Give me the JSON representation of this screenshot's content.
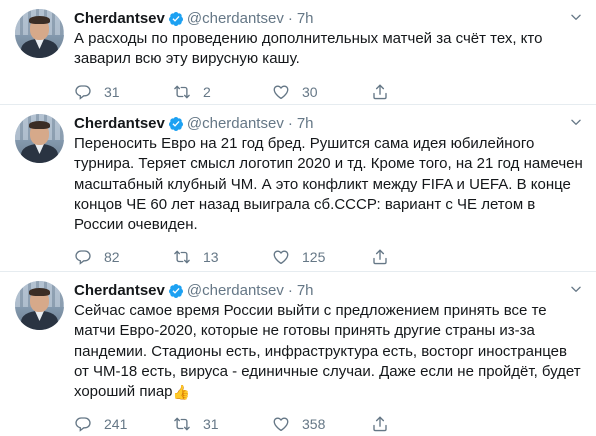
{
  "tweets": [
    {
      "name": "Cherdantsev",
      "handle": "@cherdantsev",
      "separator": "·",
      "time": "7h",
      "text": "А расходы по проведению дополнительных матчей за счёт тех, кто заварил всю эту вирусную кашу.",
      "replies": "31",
      "retweets": "2",
      "likes": "30"
    },
    {
      "name": "Cherdantsev",
      "handle": "@cherdantsev",
      "separator": "·",
      "time": "7h",
      "text": "Переносить Евро на 21 год бред. Рушится сама идея юбилейного турнира. Теряет смысл логотип 2020 и тд. Кроме того, на 21 год намечен масштабный клубный ЧМ. А это конфликт между FIFA и UEFA. В конце концов ЧЕ 60 лет назад выиграла сб.СССР: вариант с ЧЕ летом в России очевиден.",
      "replies": "82",
      "retweets": "13",
      "likes": "125"
    },
    {
      "name": "Cherdantsev",
      "handle": "@cherdantsev",
      "separator": "·",
      "time": "7h",
      "text": "Сейчас самое время России выйти с предложением принять все те матчи Евро-2020, которые не готовы принять другие страны из-за пандемии. Стадионы есть, инфраструктура есть, восторг иностранцев от ЧМ-18 есть, вируса - единичные случаи. Даже если не пройдёт, будет хороший пиар",
      "emoji": "👍",
      "replies": "241",
      "retweets": "31",
      "likes": "358"
    }
  ],
  "icons": {
    "verified": "verified-badge-icon",
    "reply": "reply-icon",
    "retweet": "retweet-icon",
    "like": "heart-icon",
    "share": "share-icon",
    "more": "chevron-down-icon"
  },
  "colors": {
    "text": "#14171a",
    "secondary": "#657786",
    "verified": "#1da1f2",
    "divider": "#e6ecf0"
  }
}
